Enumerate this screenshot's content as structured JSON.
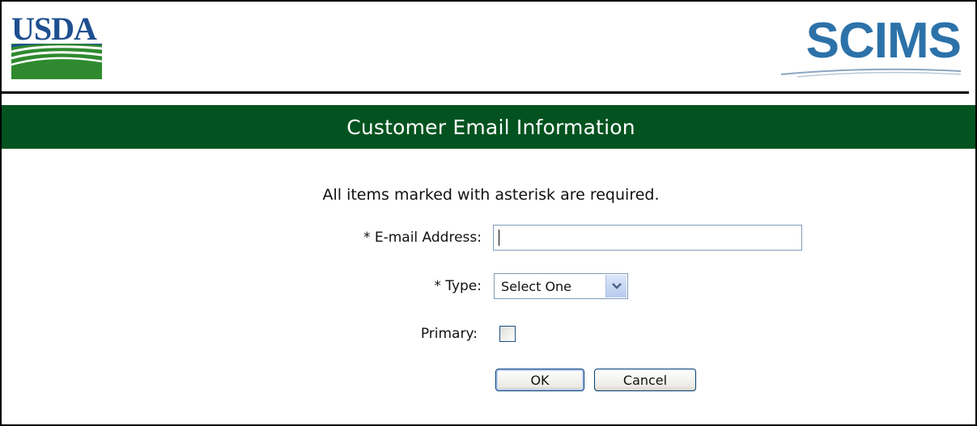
{
  "header": {
    "left_logo_text": "USDA",
    "right_logo_text": "SCIMS"
  },
  "title": "Customer Email Information",
  "form": {
    "required_note": "All items marked with asterisk are required.",
    "email_label": "* E-mail Address:",
    "email_value": "",
    "type_label": "* Type:",
    "type_selected": "Select One",
    "primary_label": "Primary:",
    "primary_checked": false
  },
  "buttons": {
    "ok_label": "OK",
    "cancel_label": "Cancel"
  },
  "colors": {
    "title_band": "#02531f",
    "usda_blue": "#1e4f8f",
    "usda_green": "#2f8a2f",
    "scims_blue": "#2c72a9"
  }
}
